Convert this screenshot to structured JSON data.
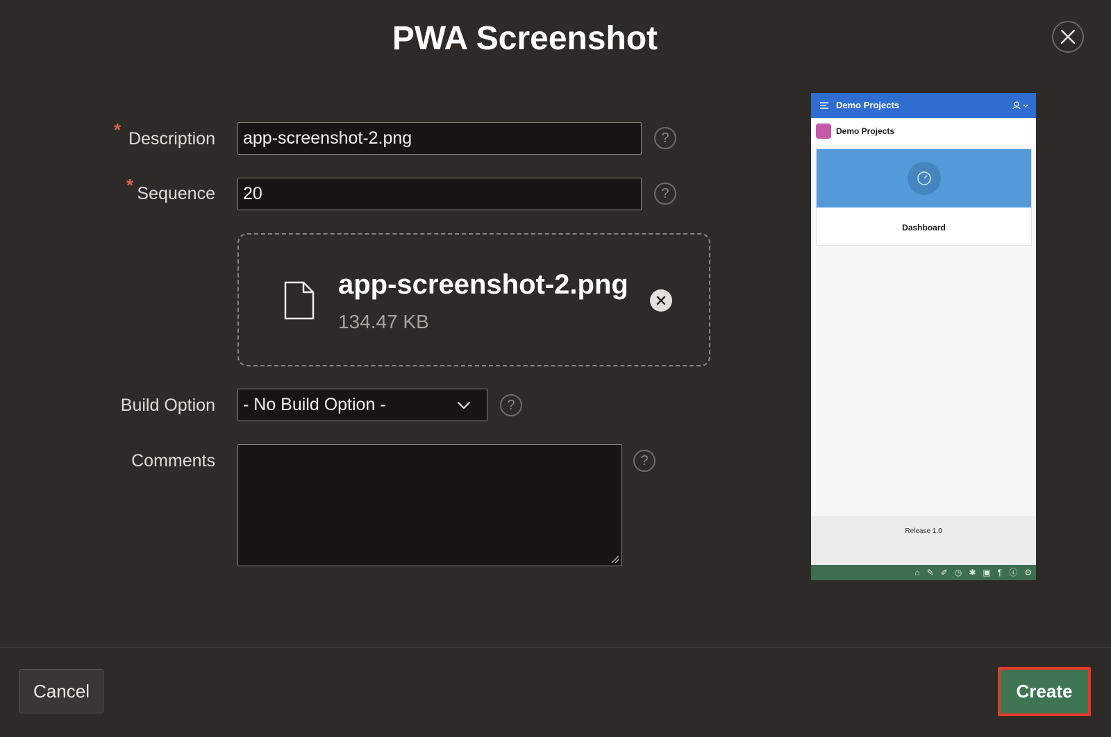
{
  "dialog": {
    "title": "PWA Screenshot"
  },
  "form": {
    "description": {
      "label": "Description",
      "value": "app-screenshot-2.png",
      "required_marker": "*"
    },
    "sequence": {
      "label": "Sequence",
      "value": "20",
      "required_marker": "*"
    },
    "upload": {
      "file_name": "app-screenshot-2.png",
      "file_size": "134.47 KB"
    },
    "build_option": {
      "label": "Build Option",
      "selected": "- No Build Option -"
    },
    "comments": {
      "label": "Comments",
      "value": ""
    },
    "help_glyph": "?"
  },
  "preview": {
    "header_title": "Demo Projects",
    "app_name": "Demo Projects",
    "card_label": "Dashboard",
    "release_text": "Release 1.0",
    "accent_color": "#2f6dd0",
    "card_color": "#539ad9",
    "toolbar_color": "#3d6f4f",
    "toolbar_icons": [
      "home-icon",
      "edit-icon",
      "edit-page-icon",
      "session-icon",
      "view-debug-icon",
      "quick-sql-icon",
      "customize-icon",
      "info-icon",
      "settings-icon"
    ]
  },
  "buttons": {
    "cancel": "Cancel",
    "create": "Create",
    "create_highlight_color": "#e23a2a"
  },
  "colors": {
    "background": "#2d2a28",
    "required": "#d9674e",
    "primary": "#3f7553"
  }
}
